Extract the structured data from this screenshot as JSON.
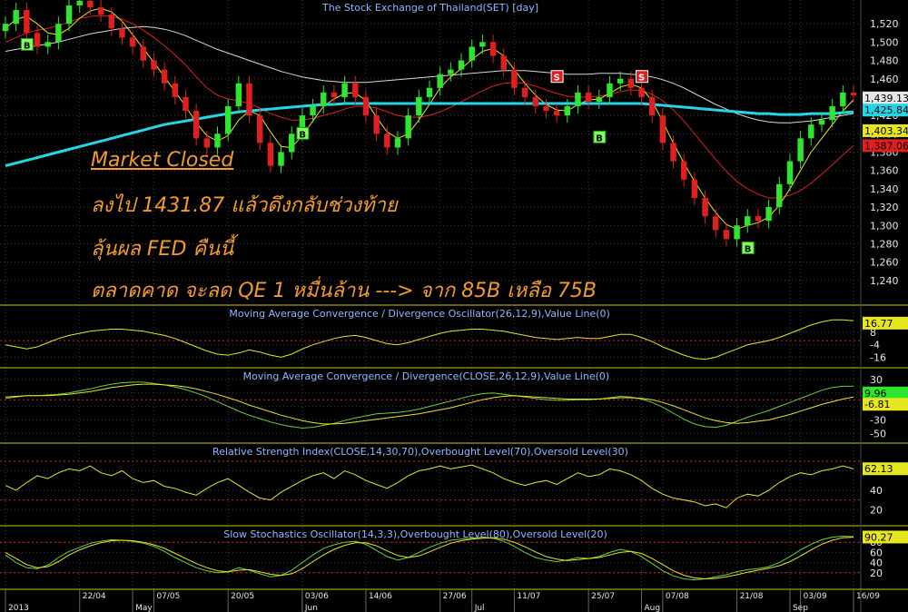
{
  "annotations": {
    "market_closed": "Market Closed",
    "line1": "ลงไป 1431.87 แล้วดึงกลับช่วงท้าย",
    "line2": "ลุ้นผล FED คืนนี้",
    "line3": "ตลาดคาด จะลด QE 1 หมื่นล้าน ---> จาก 85B เหลือ 75B"
  },
  "colors": {
    "background": "#000000",
    "grid": "#3a3a3a",
    "up_candle": "#2fe62f",
    "down_candle": "#e02020",
    "ma_cyan": "#23d6e6",
    "ma_white": "#d8d8d8",
    "ma_red": "#e02020",
    "ma_yellow": "#e6e61e",
    "osc_line": "#e6e61e",
    "signal_line": "#6ad13a",
    "title_text": "#8fb8ff",
    "level_line": "#e02020"
  },
  "chart_data": [
    {
      "type": "candlestick",
      "title": "The Stock Exchange of Thailand(SET) [day]",
      "ylim": [
        1220,
        1540
      ],
      "yticks": [
        1240,
        1260,
        1280,
        1300,
        1320,
        1340,
        1360,
        1380,
        1400,
        1420,
        1440,
        1460,
        1480,
        1500,
        1520
      ],
      "last_value_labels": [
        {
          "value": "1,439.13",
          "color": "#e6e6e6"
        },
        {
          "value": "1,425.84",
          "color": "#23d6e6"
        },
        {
          "value": "1,403.34",
          "color": "#e6e61e"
        },
        {
          "value": "1,387.06",
          "color": "#e02020"
        }
      ],
      "price": [
        1520,
        1535,
        1510,
        1495,
        1500,
        1520,
        1540,
        1545,
        1538,
        1530,
        1515,
        1505,
        1495,
        1480,
        1470,
        1455,
        1440,
        1425,
        1395,
        1385,
        1400,
        1430,
        1455,
        1420,
        1390,
        1365,
        1380,
        1400,
        1420,
        1430,
        1445,
        1440,
        1455,
        1440,
        1420,
        1400,
        1385,
        1395,
        1420,
        1440,
        1450,
        1465,
        1470,
        1480,
        1495,
        1500,
        1485,
        1470,
        1450,
        1440,
        1430,
        1425,
        1420,
        1430,
        1445,
        1435,
        1440,
        1455,
        1460,
        1450,
        1440,
        1420,
        1390,
        1370,
        1350,
        1330,
        1310,
        1295,
        1285,
        1300,
        1310,
        1305,
        1320,
        1345,
        1370,
        1395,
        1410,
        1415,
        1430,
        1445,
        1442
      ],
      "ma_cyan": [
        1365,
        1368,
        1371,
        1374,
        1377,
        1380,
        1383,
        1386,
        1389,
        1392,
        1395,
        1398,
        1401,
        1404,
        1407,
        1410,
        1412,
        1414,
        1416,
        1418,
        1420,
        1422,
        1424,
        1425,
        1426,
        1427,
        1428,
        1429,
        1430,
        1431,
        1432,
        1432,
        1433,
        1433,
        1433,
        1433,
        1433,
        1433,
        1433,
        1433,
        1433,
        1433,
        1433,
        1433,
        1433,
        1433,
        1433,
        1433,
        1433,
        1433,
        1433,
        1433,
        1433,
        1433,
        1433,
        1433,
        1433,
        1433,
        1433,
        1433,
        1433,
        1432,
        1431,
        1430,
        1429,
        1428,
        1427,
        1426,
        1425,
        1424,
        1423,
        1422,
        1422,
        1421,
        1421,
        1421,
        1422,
        1422,
        1422,
        1423,
        1424
      ],
      "ma_white": [
        1490,
        1492,
        1494,
        1496,
        1498,
        1500,
        1503,
        1506,
        1509,
        1511,
        1513,
        1515,
        1516,
        1517,
        1516,
        1514,
        1511,
        1507,
        1502,
        1497,
        1492,
        1488,
        1484,
        1480,
        1476,
        1472,
        1468,
        1465,
        1462,
        1460,
        1458,
        1457,
        1456,
        1456,
        1456,
        1457,
        1458,
        1459,
        1460,
        1461,
        1462,
        1463,
        1464,
        1465,
        1466,
        1467,
        1468,
        1469,
        1469,
        1469,
        1468,
        1467,
        1466,
        1465,
        1465,
        1465,
        1466,
        1466,
        1466,
        1465,
        1464,
        1462,
        1459,
        1455,
        1450,
        1444,
        1438,
        1432,
        1427,
        1422,
        1418,
        1415,
        1413,
        1412,
        1412,
        1413,
        1414,
        1416,
        1418,
        1420,
        1422
      ],
      "ma_red": [
        1500,
        1505,
        1510,
        1513,
        1515,
        1518,
        1522,
        1526,
        1528,
        1529,
        1528,
        1525,
        1520,
        1513,
        1505,
        1496,
        1486,
        1475,
        1462,
        1450,
        1442,
        1438,
        1436,
        1433,
        1428,
        1422,
        1418,
        1415,
        1415,
        1417,
        1420,
        1423,
        1427,
        1430,
        1430,
        1428,
        1424,
        1420,
        1418,
        1418,
        1420,
        1424,
        1429,
        1435,
        1441,
        1447,
        1452,
        1455,
        1456,
        1455,
        1452,
        1448,
        1444,
        1441,
        1440,
        1440,
        1441,
        1443,
        1446,
        1448,
        1447,
        1443,
        1436,
        1426,
        1414,
        1400,
        1386,
        1372,
        1359,
        1348,
        1340,
        1334,
        1330,
        1330,
        1333,
        1338,
        1346,
        1356,
        1366,
        1377,
        1387
      ],
      "ma_yellow": [
        1515,
        1525,
        1528,
        1520,
        1510,
        1508,
        1515,
        1526,
        1534,
        1537,
        1533,
        1523,
        1508,
        1493,
        1478,
        1462,
        1446,
        1430,
        1412,
        1398,
        1392,
        1398,
        1415,
        1425,
        1420,
        1402,
        1386,
        1385,
        1398,
        1414,
        1430,
        1438,
        1444,
        1445,
        1436,
        1418,
        1402,
        1395,
        1400,
        1415,
        1432,
        1450,
        1462,
        1471,
        1481,
        1490,
        1493,
        1485,
        1470,
        1455,
        1442,
        1432,
        1426,
        1425,
        1432,
        1437,
        1438,
        1444,
        1451,
        1454,
        1450,
        1436,
        1413,
        1390,
        1368,
        1348,
        1330,
        1314,
        1301,
        1296,
        1300,
        1303,
        1309,
        1322,
        1340,
        1360,
        1380,
        1395,
        1410,
        1425,
        1437
      ],
      "markers": [
        {
          "label": "B",
          "at": 2,
          "value": 1497
        },
        {
          "label": "B",
          "at": 28,
          "value": 1400
        },
        {
          "label": "S",
          "at": 52,
          "value": 1462
        },
        {
          "label": "B",
          "at": 56,
          "value": 1396
        },
        {
          "label": "S",
          "at": 60,
          "value": 1462
        },
        {
          "label": "B",
          "at": 70,
          "value": 1275
        }
      ]
    },
    {
      "type": "line",
      "title": "Moving Average Convergence / Divergence Oscillator(26,12,9),Value Line(0)",
      "ylim": [
        -20,
        28
      ],
      "yticks": [
        -16,
        -4,
        8
      ],
      "last_value_label": "16.77",
      "zero_level": 0,
      "series": [
        {
          "values": [
            -4,
            -6,
            -8,
            -6,
            -2,
            2,
            5,
            7,
            9,
            10,
            11,
            11,
            10,
            9,
            7,
            5,
            2,
            -2,
            -6,
            -10,
            -13,
            -14,
            -12,
            -9,
            -11,
            -14,
            -16,
            -13,
            -8,
            -4,
            -1,
            2,
            4,
            5,
            3,
            0,
            -3,
            -4,
            -2,
            1,
            4,
            7,
            9,
            10,
            11,
            11,
            10,
            9,
            7,
            5,
            3,
            2,
            1,
            2,
            3,
            2,
            2,
            4,
            6,
            6,
            3,
            -1,
            -6,
            -10,
            -14,
            -17,
            -18,
            -16,
            -12,
            -8,
            -4,
            -2,
            0,
            3,
            7,
            11,
            15,
            18,
            20,
            20,
            19
          ]
        }
      ]
    },
    {
      "type": "line",
      "title": "Moving Average Convergence / Divergence(CLOSE,26,12,9),Value Line(0)",
      "ylim": [
        -55,
        38
      ],
      "yticks": [
        -50,
        -30,
        -10,
        10,
        30
      ],
      "last_value_labels": [
        {
          "value": "9.96",
          "color": "#2fe62f"
        },
        {
          "value": "-6.81",
          "color": "#e6e61e"
        }
      ],
      "zero_level": 0,
      "series": [
        {
          "values": [
            2,
            4,
            6,
            6,
            7,
            8,
            10,
            13,
            16,
            20,
            23,
            25,
            26,
            26,
            24,
            22,
            19,
            15,
            10,
            4,
            -3,
            -10,
            -17,
            -23,
            -28,
            -33,
            -37,
            -40,
            -42,
            -41,
            -38,
            -35,
            -31,
            -27,
            -24,
            -21,
            -20,
            -19,
            -17,
            -14,
            -10,
            -6,
            -2,
            2,
            6,
            9,
            10,
            8,
            6,
            4,
            2,
            0,
            -1,
            -1,
            0,
            0,
            1,
            3,
            5,
            4,
            1,
            -4,
            -11,
            -20,
            -29,
            -36,
            -40,
            -41,
            -38,
            -32,
            -26,
            -21,
            -16,
            -10,
            -4,
            2,
            8,
            14,
            18,
            20,
            20
          ]
        },
        {
          "values": [
            4,
            5,
            6,
            6,
            6,
            7,
            8,
            10,
            12,
            15,
            18,
            20,
            22,
            23,
            23,
            22,
            21,
            19,
            16,
            12,
            8,
            3,
            -2,
            -8,
            -13,
            -18,
            -23,
            -27,
            -31,
            -34,
            -36,
            -36,
            -35,
            -33,
            -31,
            -29,
            -27,
            -25,
            -23,
            -21,
            -18,
            -15,
            -12,
            -8,
            -4,
            0,
            3,
            5,
            6,
            5,
            4,
            3,
            2,
            1,
            1,
            1,
            1,
            2,
            3,
            3,
            2,
            0,
            -4,
            -9,
            -15,
            -21,
            -27,
            -31,
            -34,
            -35,
            -34,
            -32,
            -30,
            -26,
            -22,
            -17,
            -12,
            -7,
            -3,
            1,
            4
          ]
        }
      ]
    },
    {
      "type": "line",
      "title": "Relative Strength Index(CLOSE,14,30,70),Overbought Level(70),Oversold Level(30)",
      "ylim": [
        10,
        82
      ],
      "yticks": [
        20,
        40,
        60
      ],
      "last_value_label": "62.13",
      "levels": [
        70,
        30
      ],
      "series": [
        {
          "values": [
            45,
            40,
            48,
            55,
            52,
            58,
            62,
            60,
            65,
            58,
            55,
            60,
            52,
            48,
            50,
            44,
            42,
            38,
            35,
            42,
            48,
            52,
            45,
            38,
            32,
            30,
            38,
            44,
            50,
            55,
            58,
            52,
            60,
            56,
            50,
            46,
            42,
            48,
            55,
            60,
            62,
            65,
            62,
            64,
            66,
            62,
            58,
            52,
            48,
            45,
            48,
            50,
            46,
            52,
            58,
            54,
            56,
            62,
            60,
            56,
            50,
            42,
            36,
            32,
            30,
            28,
            24,
            26,
            22,
            32,
            36,
            34,
            40,
            48,
            54,
            58,
            56,
            60,
            62,
            65,
            62
          ]
        }
      ]
    },
    {
      "type": "line",
      "title": "Slow Stochastics Oscillator(14,3,3),Overbought Level(80),Oversold Level(20)",
      "ylim": [
        0,
        100
      ],
      "yticks": [
        20,
        40,
        60,
        80
      ],
      "last_value_label": "90.27",
      "levels": [
        80,
        20
      ],
      "series": [
        {
          "values": [
            55,
            40,
            30,
            28,
            35,
            50,
            62,
            70,
            78,
            82,
            85,
            84,
            82,
            78,
            72,
            62,
            50,
            40,
            30,
            24,
            20,
            22,
            30,
            25,
            18,
            12,
            15,
            25,
            40,
            55,
            68,
            75,
            80,
            82,
            76,
            64,
            52,
            45,
            50,
            60,
            70,
            78,
            84,
            86,
            88,
            90,
            88,
            82,
            72,
            60,
            50,
            45,
            42,
            45,
            50,
            48,
            52,
            60,
            66,
            62,
            52,
            38,
            24,
            14,
            8,
            6,
            8,
            12,
            16,
            22,
            26,
            28,
            32,
            40,
            52,
            65,
            76,
            85,
            90,
            92,
            91
          ]
        },
        {
          "values": [
            60,
            48,
            36,
            30,
            32,
            42,
            55,
            65,
            73,
            79,
            83,
            84,
            83,
            80,
            75,
            68,
            58,
            48,
            38,
            30,
            24,
            22,
            25,
            26,
            22,
            17,
            15,
            18,
            28,
            42,
            55,
            66,
            74,
            79,
            79,
            73,
            63,
            54,
            50,
            53,
            61,
            70,
            78,
            83,
            86,
            88,
            89,
            86,
            80,
            71,
            61,
            52,
            47,
            44,
            46,
            48,
            50,
            55,
            60,
            62,
            58,
            48,
            36,
            24,
            15,
            10,
            8,
            9,
            12,
            16,
            21,
            25,
            29,
            34,
            42,
            53,
            65,
            76,
            84,
            89,
            90
          ]
        }
      ]
    }
  ],
  "x_axis": {
    "labels": [
      {
        "text": "2013",
        "at": 0
      },
      {
        "text": "22/04",
        "at": 7
      },
      {
        "text": "May",
        "at": 12
      },
      {
        "text": "07/05",
        "at": 14
      },
      {
        "text": "20/05",
        "at": 21
      },
      {
        "text": "03/06",
        "at": 28
      },
      {
        "text": "Jun",
        "at": 28
      },
      {
        "text": "14/06",
        "at": 34
      },
      {
        "text": "27/06",
        "at": 41
      },
      {
        "text": "Jul",
        "at": 44
      },
      {
        "text": "11/07",
        "at": 48
      },
      {
        "text": "25/07",
        "at": 55
      },
      {
        "text": "Aug",
        "at": 60
      },
      {
        "text": "07/08",
        "at": 62
      },
      {
        "text": "21/08",
        "at": 69
      },
      {
        "text": "03/09",
        "at": 75
      },
      {
        "text": "Sep",
        "at": 74
      },
      {
        "text": "16/09",
        "at": 80
      }
    ]
  }
}
